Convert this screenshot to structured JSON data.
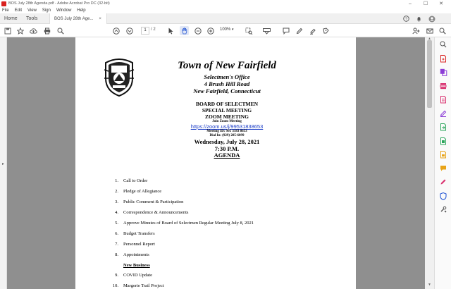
{
  "window": {
    "title": "BOS July 28th Agenda.pdf - Adobe Acrobat Pro DC (32-bit)",
    "controls": [
      "–",
      "☐",
      "✕"
    ]
  },
  "menu": [
    "File",
    "Edit",
    "View",
    "Sign",
    "Window",
    "Help"
  ],
  "tabs": {
    "home": "Home",
    "tools": "Tools",
    "document": "BOS July 28th Age...",
    "close": "×"
  },
  "toolbar": {
    "page_current": "1",
    "page_total": "/ 2",
    "zoom": "100%",
    "icons": [
      "save-icon",
      "bookmark-star-icon",
      "upload-icon",
      "print-icon",
      "zoom-search-icon",
      "prev-page-icon",
      "next-page-icon",
      "select-cursor-icon",
      "hand-icon",
      "zoom-out-icon",
      "zoom-in-icon",
      "marquee-zoom-icon",
      "keyboard-icon",
      "comment-icon",
      "pen-icon",
      "highlight-icon",
      "stamp-icon",
      "share-icon",
      "email-icon",
      "search-icon"
    ]
  },
  "document": {
    "town": "Town of New Fairfield",
    "office": "Selectmen's Office",
    "address1": "4 Brush Hill Road",
    "address2": "New Fairfield, Connecticut",
    "board": "BOARD OF SELECTMEN",
    "special": "SPECIAL MEETING",
    "zoom": "ZOOM MEETING",
    "join": "Join Zoom Meeting",
    "link": "https://zoom.us/j/99531838653",
    "meeting_id": "Meeting ID: 995 3183 8653",
    "dial": "Dial In: (929) 205-6099",
    "date": "Wednesday, July 28, 2021",
    "time": "7:30 P.M.",
    "agenda": "AGENDA",
    "items": [
      {
        "n": "1.",
        "text": "Call to Order"
      },
      {
        "n": "2.",
        "text": "Pledge of Allegiance"
      },
      {
        "n": "3.",
        "text": "Public Comment & Participation"
      },
      {
        "n": "4.",
        "text": "Correspondence & Announcements"
      },
      {
        "n": "5.",
        "text": "Approve Minutes of Board of Selectmen Regular Meeting July 8, 2021"
      },
      {
        "n": "6.",
        "text": "Budget Transfers"
      },
      {
        "n": "7.",
        "text": "Personnel Report"
      },
      {
        "n": "8.",
        "text": "Appointments"
      }
    ],
    "new_business": "New Business",
    "items2": [
      {
        "n": "9.",
        "text": "COVID Update"
      },
      {
        "n": "10.",
        "text": "Margerie Trail Project"
      }
    ]
  },
  "sidebar_tools": [
    {
      "name": "search-tool-icon",
      "color": "#555555"
    },
    {
      "name": "create-pdf-icon",
      "color": "#d9201e"
    },
    {
      "name": "combine-files-icon",
      "color": "#8b3dd6"
    },
    {
      "name": "organize-pages-icon",
      "color": "#d9306f"
    },
    {
      "name": "edit-pdf-icon",
      "color": "#d9306f"
    },
    {
      "name": "fill-sign-icon",
      "color": "#8b3dd6"
    },
    {
      "name": "export-pdf-icon",
      "color": "#2aa55a"
    },
    {
      "name": "send-for-signature-icon",
      "color": "#2aa55a"
    },
    {
      "name": "scan-ocr-icon",
      "color": "#e8a317"
    },
    {
      "name": "comment-tool-icon",
      "color": "#e8a317"
    },
    {
      "name": "redact-icon",
      "color": "#d9306f"
    },
    {
      "name": "protect-icon",
      "color": "#2b5cd6"
    },
    {
      "name": "more-tools-icon",
      "color": "#555555"
    }
  ]
}
